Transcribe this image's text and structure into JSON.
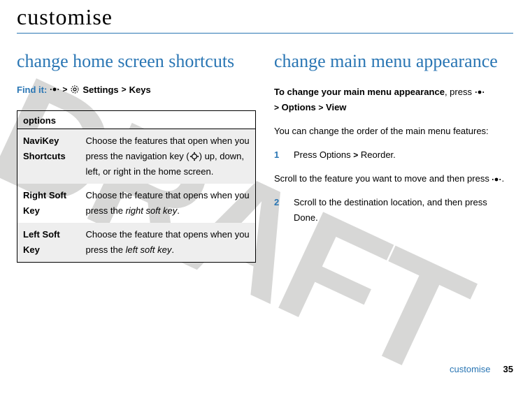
{
  "watermark": "DRAFT",
  "page": {
    "title": "customise",
    "footer_label": "customise",
    "footer_page": "35"
  },
  "left": {
    "heading": "change home screen shortcuts",
    "find_it_label": "Find it:",
    "gt": ">",
    "path_settings": "Settings",
    "path_keys": "Keys",
    "table_header": "options",
    "rows": [
      {
        "name": "NaviKey Shortcuts",
        "desc_before": "Choose the features that open when you press the navigation key (",
        "desc_after": ") up, down, left, or right in the home screen."
      },
      {
        "name": "Right Soft Key",
        "desc_before": "Choose the feature that opens when you press the ",
        "desc_ital": "right soft key",
        "desc_after": "."
      },
      {
        "name": "Left Soft Key",
        "desc_before": "Choose the feature that opens when you press the ",
        "desc_ital": "left soft key",
        "desc_after": "."
      }
    ]
  },
  "right": {
    "heading": "change main menu appearance",
    "lead_strong": "To change your main menu appearance",
    "lead_after": ", press ",
    "gt": ">",
    "path_options": "Options",
    "path_view": "View",
    "body1": "You can change the order of the main menu features:",
    "step1_num": "1",
    "step1_before": "Press ",
    "step1_options": "Options",
    "step1_gt": ">",
    "step1_reorder": "Reorder",
    "step1_after": ".",
    "body2_before": "Scroll to the feature you want to move and then press ",
    "body2_after": ".",
    "step2_num": "2",
    "step2_before": "Scroll to the destination location, and then press ",
    "step2_done": "Done",
    "step2_after": "."
  },
  "icons": {
    "center_key": "center-key-icon",
    "gear": "gear-icon",
    "navkey": "nav-key-icon"
  }
}
